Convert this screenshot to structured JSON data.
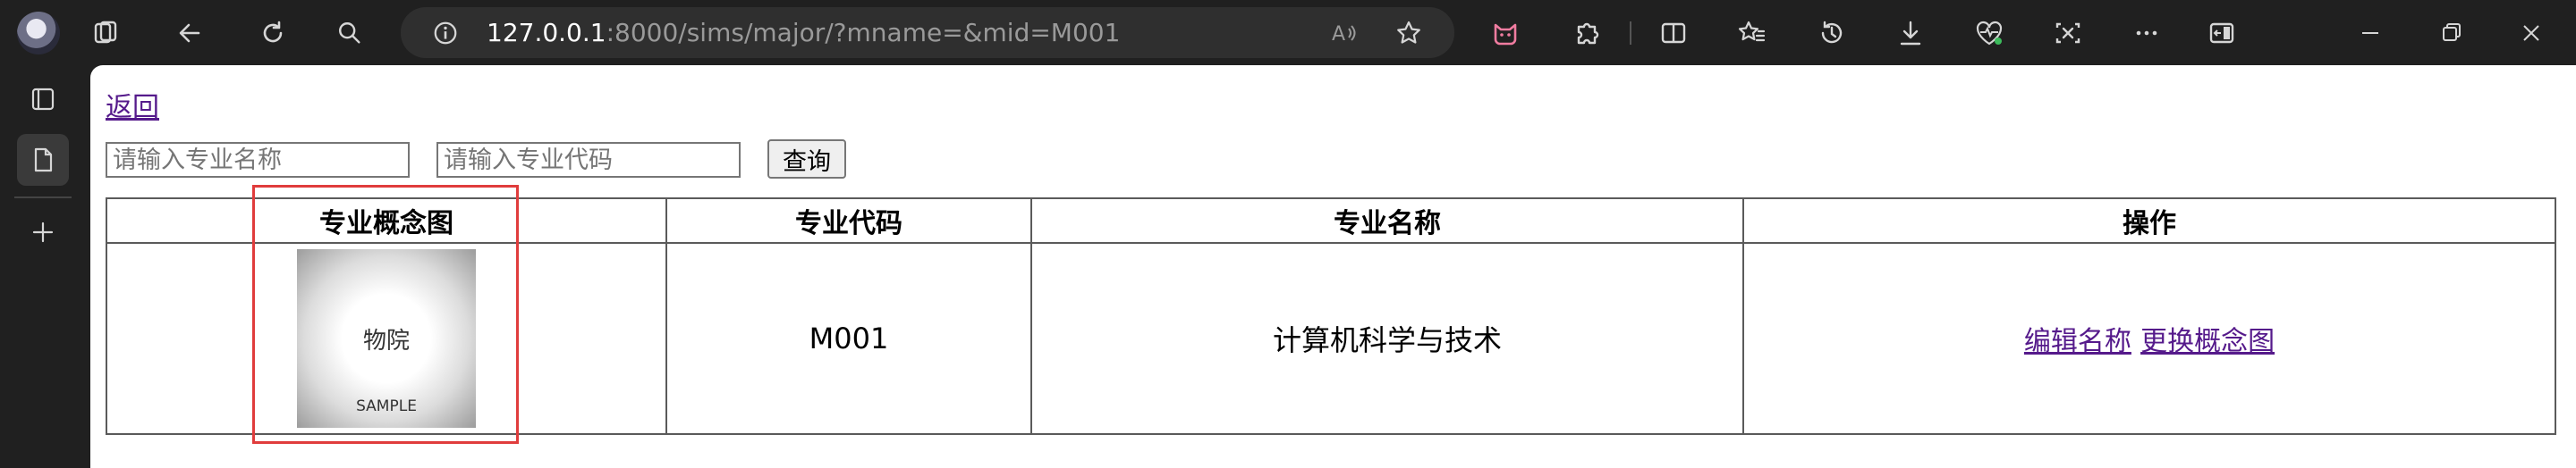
{
  "browser": {
    "url_host": "127.0.0.1",
    "url_rest": ":8000/sims/major/?mname=&mid=M001",
    "icons": [
      "avatar",
      "tab-actions-icon",
      "back-icon",
      "refresh-icon",
      "search-icon",
      "site-info-icon",
      "read-aloud-icon",
      "favorite-star-icon",
      "extension-cat-icon",
      "extensions-icon",
      "split-screen-icon",
      "favorites-icon",
      "history-icon",
      "downloads-icon",
      "browser-essentials-icon",
      "screenshot-icon",
      "more-icon",
      "sidebar-toggle-icon",
      "minimize-icon",
      "restore-icon",
      "close-icon"
    ]
  },
  "sidebar": {
    "icons": [
      "vertical-tabs-icon",
      "page-tab-icon",
      "new-tab-icon"
    ]
  },
  "page": {
    "back_link": "返回",
    "search": {
      "name_placeholder": "请输入专业名称",
      "code_placeholder": "请输入专业代码",
      "query_button": "查询"
    },
    "table": {
      "headers": [
        "专业概念图",
        "专业代码",
        "专业名称",
        "操作"
      ],
      "rows": [
        {
          "image_text": "物院",
          "image_watermark": "SAMPLE",
          "code": "M001",
          "name": "计算机科学与技术",
          "actions": [
            "编辑名称",
            "更换概念图"
          ]
        }
      ]
    },
    "highlight_color": "#e03c3c"
  }
}
